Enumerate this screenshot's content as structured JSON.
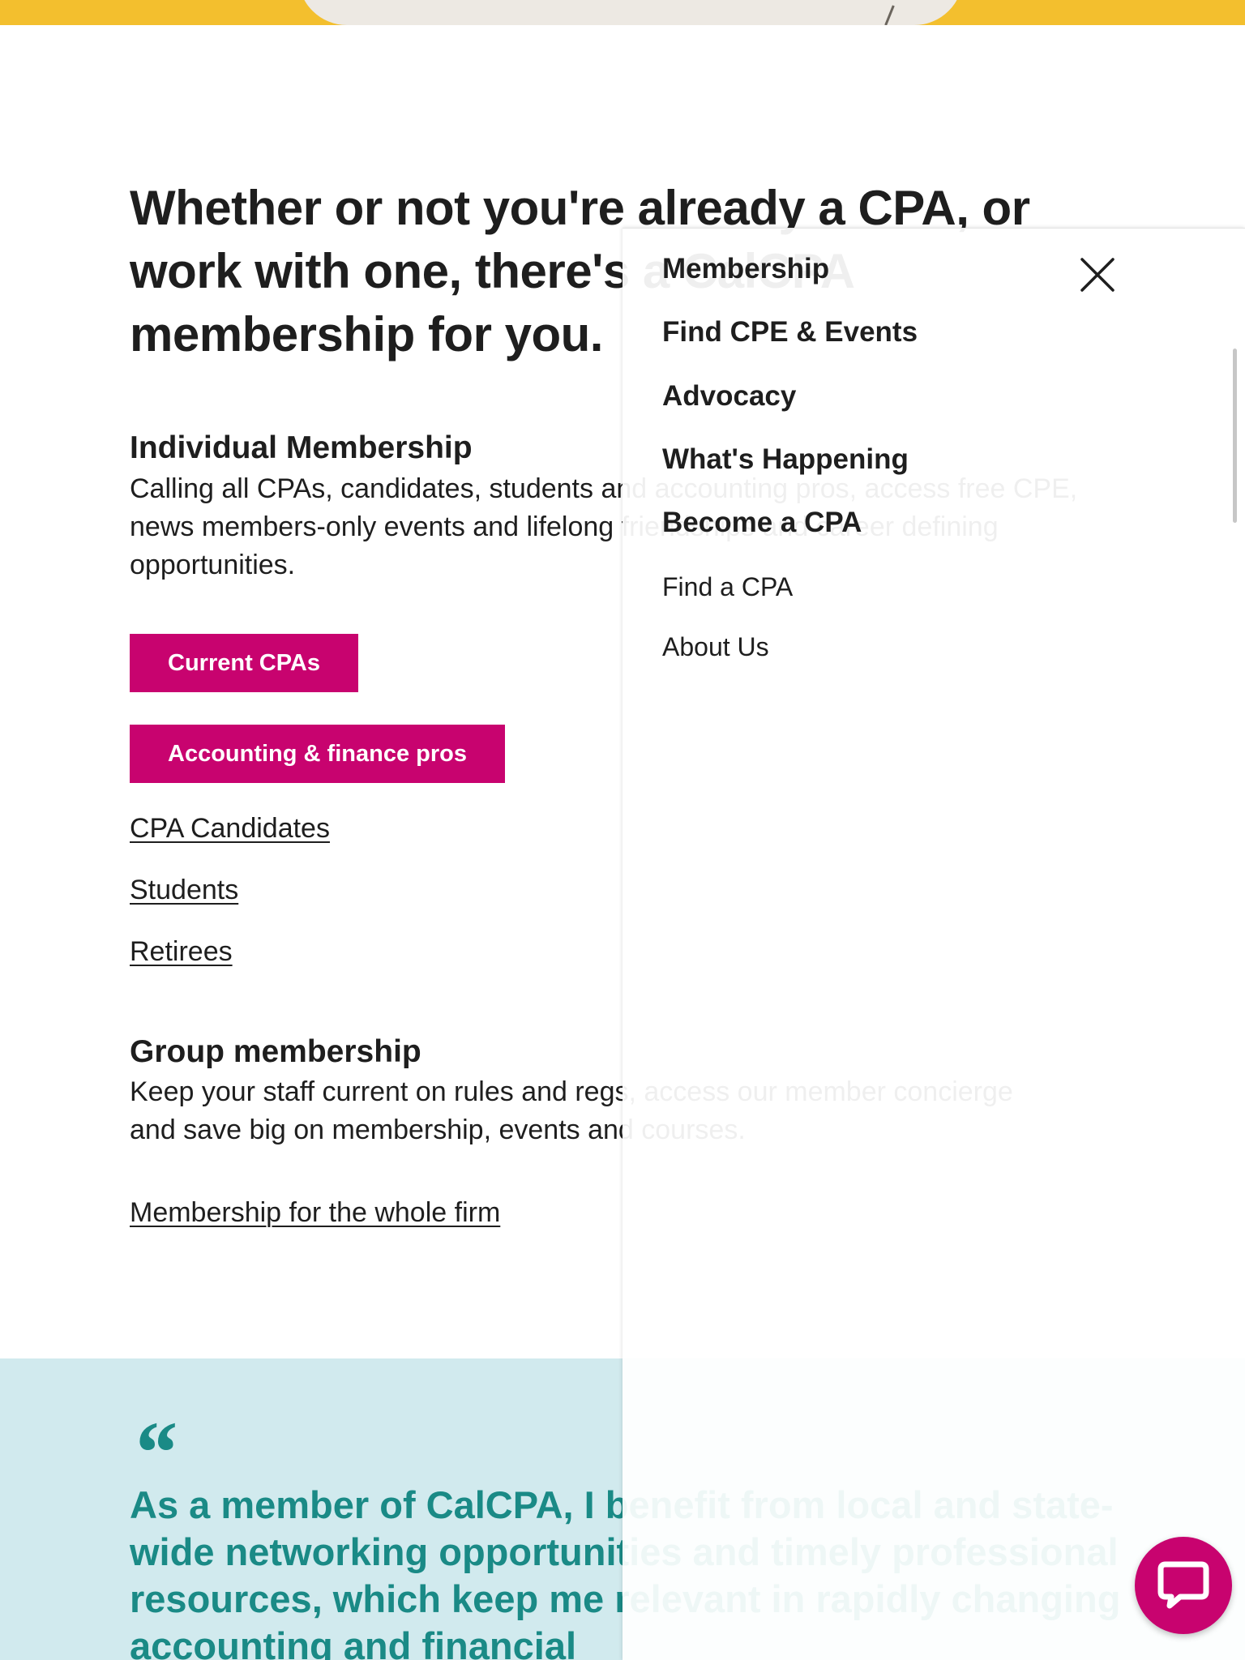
{
  "headline": "Whether or not you're already a CPA, or work with one, there's a CalCPA membership for you.",
  "individual": {
    "title": "Individual Membership",
    "description": "Calling all CPAs, candidates, students and accounting pros, access free CPE, news members-only events and lifelong friendships and career defining opportunities.",
    "buttons": [
      "Current CPAs",
      "Accounting & finance pros"
    ],
    "links": [
      "CPA Candidates",
      "Students",
      "Retirees"
    ]
  },
  "group": {
    "title": "Group membership",
    "description": "Keep your staff current on rules and regs, access our member concierge and save big on membership, events and courses.",
    "link": "Membership for the whole firm"
  },
  "testimonial": {
    "mark": "“",
    "quote": "As a member of CalCPA, I benefit from local and state-wide networking opportunities and timely professional resources, which keep me relevant in rapidly changing accounting and financial"
  },
  "drawer": {
    "primary_items": [
      "Membership",
      "Find CPE & Events",
      "Advocacy",
      "What's Happening",
      "Become a CPA"
    ],
    "secondary_items": [
      "Find a CPA",
      "About Us"
    ]
  },
  "icons": {
    "close": "close-icon",
    "chat": "chat-bubble-icon"
  },
  "colors": {
    "brand_pink": "#c8036f",
    "teal_text": "#1a8a86",
    "quote_band": "#d1eaee",
    "hero_yellow": "#f3bf2e"
  }
}
